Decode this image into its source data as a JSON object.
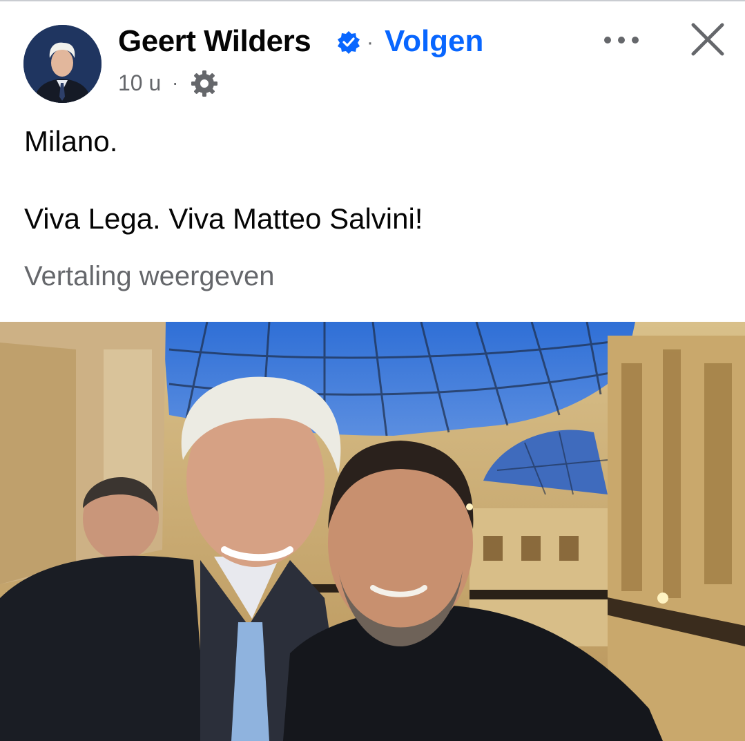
{
  "post": {
    "author": "Geert Wilders",
    "verified": true,
    "separator": "·",
    "follow_label": "Volgen",
    "time": "10 u",
    "meta_separator": "·",
    "audience_icon": "gear-icon",
    "text_line1": "Milano.",
    "text_line2": "Viva Lega. Viva Matteo Salvini!",
    "translate_label": "Vertaling weergeven"
  },
  "icons": {
    "verified": "verified-badge-icon",
    "more": "more-options-icon",
    "close": "close-icon"
  },
  "colors": {
    "link_blue": "#0866ff",
    "secondary_text": "#65676b",
    "primary_text": "#050505"
  }
}
